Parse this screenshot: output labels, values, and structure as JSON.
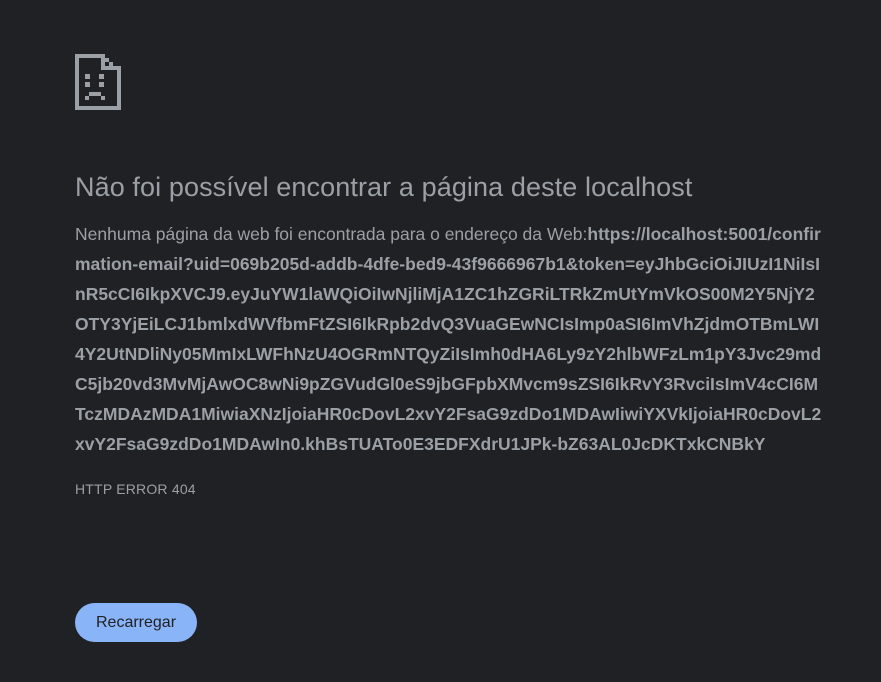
{
  "page": {
    "icon": "sad-page-icon",
    "title": "Não foi possível encontrar a página deste localhost",
    "description_prefix": "Nenhuma página da web foi encontrada para o endereço da Web:",
    "url": "https://localhost:5001/confirmation-email?uid=069b205d-addb-4dfe-bed9-43f9666967b1&token=eyJhbGciOiJIUzI1NiIsInR5cCI6IkpXVCJ9.eyJuYW1laWQiOiIwNjliMjA1ZC1hZGRiLTRkZmUtYmVkOS00M2Y5NjY2OTY3YjEiLCJ1bmlxdWVfbmFtZSI6IkRpb2dvQ3VuaGEwNCIsImp0aSI6ImVhZjdmOTBmLWI4Y2UtNDliNy05MmIxLWFhNzU4OGRmNTQyZiIsImh0dHA6Ly9zY2hlbWFzLm1pY3Jvc29mdC5jb20vd3MvMjAwOC8wNi9pZGVudGl0eS9jbGFpbXMvcm9sZSI6IkRvY3RvciIsImV4cCI6MTczMDAzMDA1MiwiaXNzIjoiaHR0cDovL2xvY2FsaG9zdDo1MDAwIiwiYXVkIjoiaHR0cDovL2xvY2FsaG9zdDo1MDAwIn0.khBsTUATo0E3EDFXdrU1JPk-bZ63AL0JcDKTxkCNBkY",
    "error_code": "HTTP ERROR 404",
    "reload_label": "Recarregar"
  },
  "colors": {
    "background": "#202124",
    "text": "#9aa0a6",
    "button": "#8ab4f8",
    "button_text": "#202124"
  }
}
